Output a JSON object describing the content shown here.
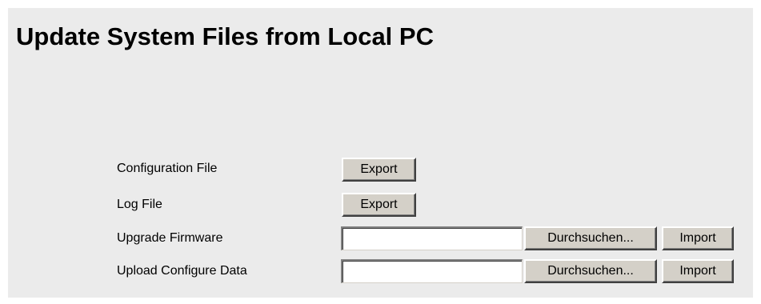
{
  "page": {
    "title": "Update System Files from Local PC"
  },
  "rows": [
    {
      "label": "Configuration File",
      "button_label": "Export"
    },
    {
      "label": "Log File",
      "button_label": "Export"
    },
    {
      "label": "Upgrade Firmware",
      "file_value": "",
      "browse_label": "Durchsuchen...",
      "button_label": "Import"
    },
    {
      "label": "Upload Configure Data",
      "file_value": "",
      "browse_label": "Durchsuchen...",
      "button_label": "Import"
    }
  ],
  "colors": {
    "panel_background": "#ebebeb",
    "button_face": "#d4d0c8"
  }
}
